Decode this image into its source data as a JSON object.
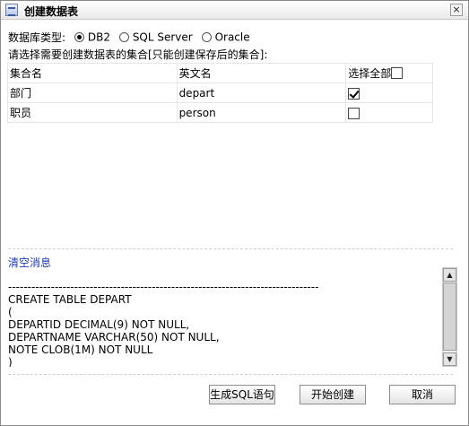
{
  "window": {
    "title": "创建数据表",
    "close_glyph": "×"
  },
  "database": {
    "label": "数据库类型:",
    "options": [
      {
        "label": "DB2",
        "checked": true
      },
      {
        "label": "SQL Server",
        "checked": false
      },
      {
        "label": "Oracle",
        "checked": false
      }
    ]
  },
  "hint": "请选择需要创建数据表的集合[只能创建保存后的集合]:",
  "table": {
    "headers": [
      "集合名",
      "英文名",
      "选择全部"
    ],
    "rows": [
      {
        "name": "部门",
        "english": "depart",
        "checked": true
      },
      {
        "name": "职员",
        "english": "person",
        "checked": false
      }
    ]
  },
  "log": {
    "clear_link": "清空消息",
    "separator": "--------------------------------------------------------------------------------",
    "lines": [
      "CREATE TABLE DEPART",
      "(",
      "DEPARTID DECIMAL(9) NOT NULL,",
      "DEPARTNAME VARCHAR(50) NOT NULL,",
      "NOTE CLOB(1M) NOT NULL",
      ")"
    ]
  },
  "buttons": {
    "generate": "生成SQL语句",
    "start": "开始创建",
    "cancel": "取消"
  },
  "icons": {
    "window": "table-icon",
    "close": "close-icon",
    "scroll_up": "arrow-up-icon",
    "scroll_down": "arrow-down-icon"
  }
}
